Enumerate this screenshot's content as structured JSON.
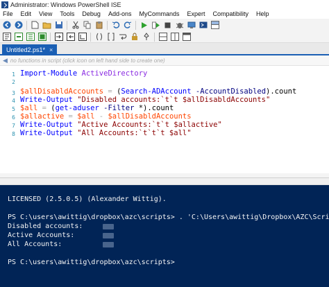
{
  "window": {
    "title": "Administrator: Windows PowerShell ISE"
  },
  "menu": [
    "File",
    "Edit",
    "View",
    "Tools",
    "Debug",
    "Add-ons",
    "MyCommands",
    "Expert",
    "Compatibility",
    "Help"
  ],
  "tab": {
    "label": "Untitled2.ps1*",
    "close": "×"
  },
  "function_bar": {
    "placeholder": "no functions in script (click icon on left hand side to create one)"
  },
  "editor": {
    "line_numbers": [
      "1",
      "2",
      "3",
      "4",
      "5",
      "6",
      "7",
      "8"
    ],
    "lines": [
      {
        "t1": "Import-Module",
        "t2": "ActiveDirectory"
      },
      {},
      {
        "t1": "$allDisabldAccounts",
        "t2": " = ",
        "t3": "(",
        "t4": "Search-ADAccount",
        "t5": " -AccountDisabled",
        "t6": ").count"
      },
      {
        "t1": "Write-Output",
        "t2": " \"Disabled accounts:`t`t $allDisabldAccounts\""
      },
      {
        "t1": "$all",
        "t2": " = ",
        "t3": "(",
        "t4": "get-aduser",
        "t5": " -Filter",
        "t6": " *",
        "t7": ").count"
      },
      {
        "t1": "$allactive",
        "t2": " = ",
        "t3": "$all",
        "t4": " - ",
        "t5": "$allDisabldAccounts"
      },
      {
        "t1": "Write-Output",
        "t2": " \"Active Accounts:`t`t $allactive\""
      },
      {
        "t1": "Write-Output",
        "t2": " \"All Accounts:`t`t`t $all\""
      }
    ]
  },
  "console": {
    "lines": [
      "LICENSED (2.5.0.5) (Alexander Wittig).",
      "PS C:\\users\\awittig\\dropbox\\azc\\scripts> . 'C:\\Users\\awittig\\Dropbox\\AZC\\Scripts\\U",
      "Disabled accounts:",
      "Active Accounts:",
      "All Accounts:",
      "PS C:\\users\\awittig\\dropbox\\azc\\scripts>"
    ]
  },
  "colors": {
    "console_bg": "#012456",
    "tab_active": "#1a5fb4",
    "cmdlet": "#0000ff",
    "variable": "#ff4500",
    "string": "#8b0000",
    "parameter": "#000080"
  },
  "icons": {
    "toolbar_row1": [
      "back-icon",
      "forward-icon",
      "new-file-icon",
      "open-folder-icon",
      "save-icon",
      "cut-icon",
      "copy-icon",
      "paste-icon",
      "undo-icon",
      "redo-icon",
      "run-icon",
      "run-selection-icon",
      "stop-icon",
      "debug-icon",
      "remote-icon",
      "powershell-icon",
      "layout-icon"
    ],
    "toolbar_row2": [
      "snippet-icon",
      "format-icon",
      "comment-icon",
      "uncomment-icon",
      "indent-icon",
      "outdent-icon",
      "region-icon",
      "parens-icon",
      "brackets-icon",
      "wrap-icon",
      "lock-icon",
      "pin-icon",
      "tile-icon",
      "tile-vertical-icon",
      "max-icon"
    ]
  }
}
